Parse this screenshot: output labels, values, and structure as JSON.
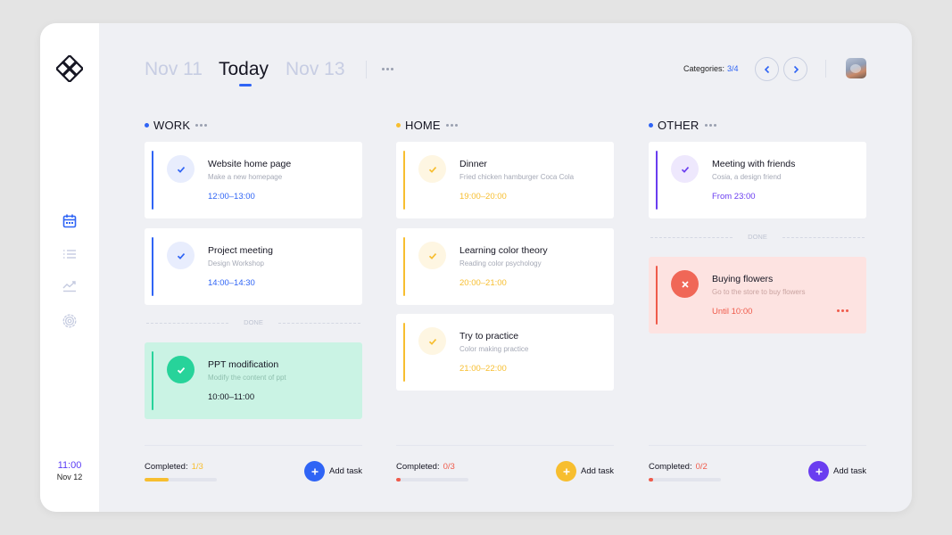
{
  "sidebar": {
    "logo_icon": "diamond-knot-logo",
    "nav": [
      {
        "icon": "calendar-icon",
        "active": true
      },
      {
        "icon": "list-icon",
        "active": false
      },
      {
        "icon": "trend-chart-icon",
        "active": false
      },
      {
        "icon": "settings-icon",
        "active": false
      }
    ],
    "time": "11:00",
    "date": "Nov 12"
  },
  "header": {
    "tabs": [
      {
        "label": "Nov 11",
        "active": false
      },
      {
        "label": "Today",
        "active": true
      },
      {
        "label": "Nov 13",
        "active": false
      }
    ],
    "categories_label": "Categories:",
    "categories_value": "3/4"
  },
  "colors": {
    "blue": "#2f64f5",
    "yellow": "#f7be2f",
    "purple": "#6a3df0",
    "green": "#27d39a",
    "red": "#ef5b4b"
  },
  "done_label": "DONE",
  "add_label": "Add task",
  "completed_label": "Completed:",
  "columns": [
    {
      "title": "WORK",
      "completed": "1/3",
      "progress": 0.333,
      "tasks": [
        {
          "title": "Website home page",
          "subtitle": "Make a new homepage",
          "time": "12:00–13:00"
        },
        {
          "title": "Project meeting",
          "subtitle": "Design Workshop",
          "time": "14:00–14:30"
        }
      ],
      "done_tasks": [
        {
          "title": "PPT modification",
          "subtitle": "Modify the content of ppt",
          "time": "10:00–11:00"
        }
      ]
    },
    {
      "title": "HOME",
      "completed": "0/3",
      "progress": 0.0,
      "tasks": [
        {
          "title": "Dinner",
          "subtitle": "Fried chicken hamburger Coca Cola",
          "time": "19:00–20:00"
        },
        {
          "title": "Learning color theory",
          "subtitle": "Reading color psychology",
          "time": "20:00–21:00"
        },
        {
          "title": "Try to practice",
          "subtitle": "Color making practice",
          "time": "21:00–22:00"
        }
      ],
      "done_tasks": []
    },
    {
      "title": "OTHER",
      "completed": "0/2",
      "progress": 0.0,
      "tasks": [
        {
          "title": "Meeting with friends",
          "subtitle": "Cosia, a design friend",
          "time": "From 23:00"
        }
      ],
      "done_tasks": [
        {
          "title": "Buying flowers",
          "subtitle": "Go to the store to buy flowers",
          "time": "Until 10:00"
        }
      ]
    }
  ]
}
